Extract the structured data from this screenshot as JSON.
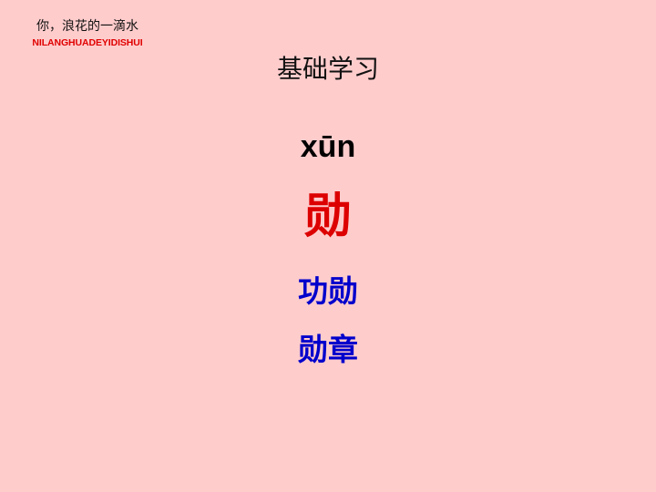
{
  "brand": {
    "chinese": "你，浪花的一滴水",
    "pinyin": "NILANGHUADEYIDISHUI"
  },
  "slide": {
    "title": "基础学习",
    "pinyin": "xūn",
    "character": "勋",
    "words": [
      "功勋",
      "勋章"
    ]
  },
  "colors": {
    "background": "#FFCCCC",
    "brand_pinyin": "#E00000",
    "character": "#DD0000",
    "words": "#0000CC"
  }
}
